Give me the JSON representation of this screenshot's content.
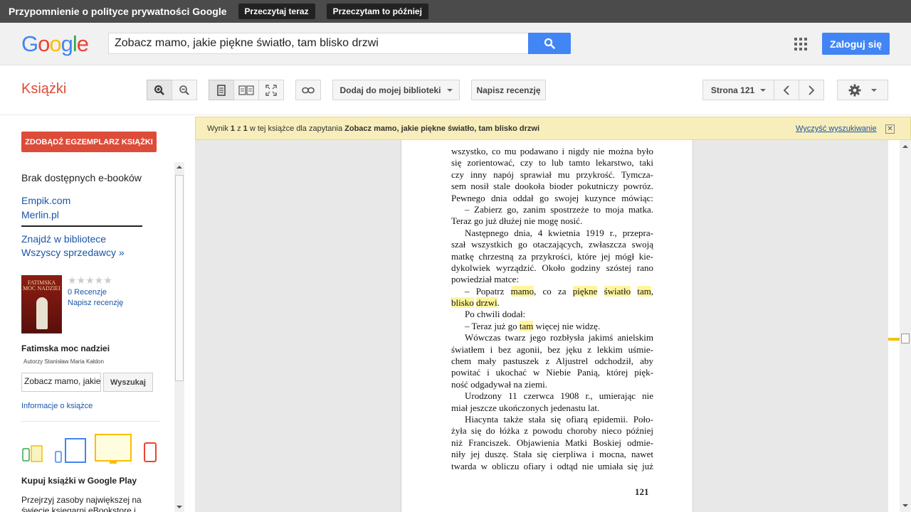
{
  "privacy_bar": {
    "text": "Przypomnienie o polityce prywatności Google",
    "read_now": "Przeczytaj teraz",
    "read_later": "Przeczytam to później"
  },
  "header": {
    "logo": {
      "g1": "G",
      "o1": "o",
      "o2": "o",
      "g2": "g",
      "l": "l",
      "e": "e"
    },
    "search_value": "Zobacz mamo, jakie piękne światło, tam blisko drzwi",
    "signin": "Zaloguj się"
  },
  "toolbar": {
    "brand": "Książki",
    "add_to_library": "Dodaj do mojej biblioteki",
    "write_review": "Napisz recenzję",
    "page_label": "Strona 121"
  },
  "sidebar": {
    "get_copy": "ZDOBĄDŹ EGZEMPLARZ KSIĄŻKI",
    "no_ebooks": "Brak dostępnych e-booków",
    "store1": "Empik.com",
    "store2": "Merlin.pl",
    "find_library": "Znajdź w bibliotece",
    "all_sellers": "Wszyscy sprzedawcy »",
    "cover_title": "FATIMSKA MOC NADZIEI",
    "rating_stars": "★★★★★",
    "reviews": "0 Recenzje",
    "write_review": "Napisz recenzję",
    "book_title": "Fatimska moc nadziei",
    "authors": "Autorzy Stanisław Maria Kałdon",
    "search_value": "Zobacz mamo, jakie piękne światło, tam blisko drzwi",
    "search_btn": "Wyszukaj",
    "about": "Informacje o książce",
    "play_heading": "Kupuj książki w Google Play",
    "play_desc": "Przejrzyj zasoby największej na świecie księgarni eBookstore i"
  },
  "result_bar": {
    "prefix": "Wynik ",
    "n": "1",
    "of": " z ",
    "total": "1",
    "mid": " w tej książce dla zapytania ",
    "query": "Zobacz mamo, jakie piękne światło, tam blisko drzwi",
    "clear": "Wyczyść wyszukiwanie",
    "close": "✕"
  },
  "page": {
    "number": "121",
    "lines": [
      "wszystko, co mu podawano i nigdy nie można było",
      "się zorientować, czy to lub tamto lekarstwo, taki",
      "czy inny napój sprawiał mu przykrość. Tymcza-",
      "sem nosił stale dookoła bioder pokutniczy powróz.",
      "Pewnego dnia oddał go swojej kuzynce mówiąc:",
      "– Zabierz go, zanim spostrzeże to moja matka.",
      "Teraz go już dłużej nie mogę nosić.",
      "Następnego dnia, 4 kwietnia 1919 r., przepra-",
      "szał wszystkich go otaczających, zwłaszcza swoją",
      "matkę chrzestną za przykrości, które jej mógł kie-",
      "dykolwiek wyrządzić. Około godziny szóstej rano",
      "powiedział matce:",
      "– Popatrz mamo, co za piękne światło tam,",
      "blisko drzwi.",
      "Po chwili dodał:",
      "– Teraz już go tam więcej nie widzę.",
      "Wówczas twarz jego rozbłysła jakimś anielskim",
      "światłem i bez agonii, bez jęku z lekkim uśmie-",
      "chem mały pastuszek z Aljustrel odchodził, aby",
      "powitać i ukochać w Niebie Panią, której pięk-",
      "ność odgadywał na ziemi.",
      "Urodzony 11 czerwca 1908 r., umierając nie",
      "miał jeszcze ukończonych jedenastu lat.",
      "Hiacynta także stała się ofiarą epidemii. Poło-",
      "żyła się do łóżka z powodu choroby nieco później",
      "niż Franciszek. Objawienia Matki Boskiej odmie-",
      "niły jej duszę. Stała się cierpliwa i mocna, nawet",
      "twarda w obliczu ofiary i odtąd nie umiała się już"
    ],
    "indent": [
      false,
      false,
      false,
      false,
      false,
      true,
      false,
      true,
      false,
      false,
      false,
      false,
      true,
      false,
      true,
      true,
      true,
      false,
      false,
      false,
      false,
      true,
      false,
      true,
      false,
      false,
      false,
      false
    ],
    "end": [
      false,
      false,
      false,
      false,
      false,
      false,
      true,
      false,
      false,
      false,
      false,
      true,
      false,
      true,
      true,
      true,
      false,
      false,
      false,
      false,
      true,
      false,
      true,
      false,
      false,
      false,
      false,
      false
    ]
  },
  "colors": {
    "accent_blue": "#4285f4",
    "brand_red": "#dd4b39",
    "highlight": "#fff59d",
    "result_bar": "#f8eebb"
  }
}
